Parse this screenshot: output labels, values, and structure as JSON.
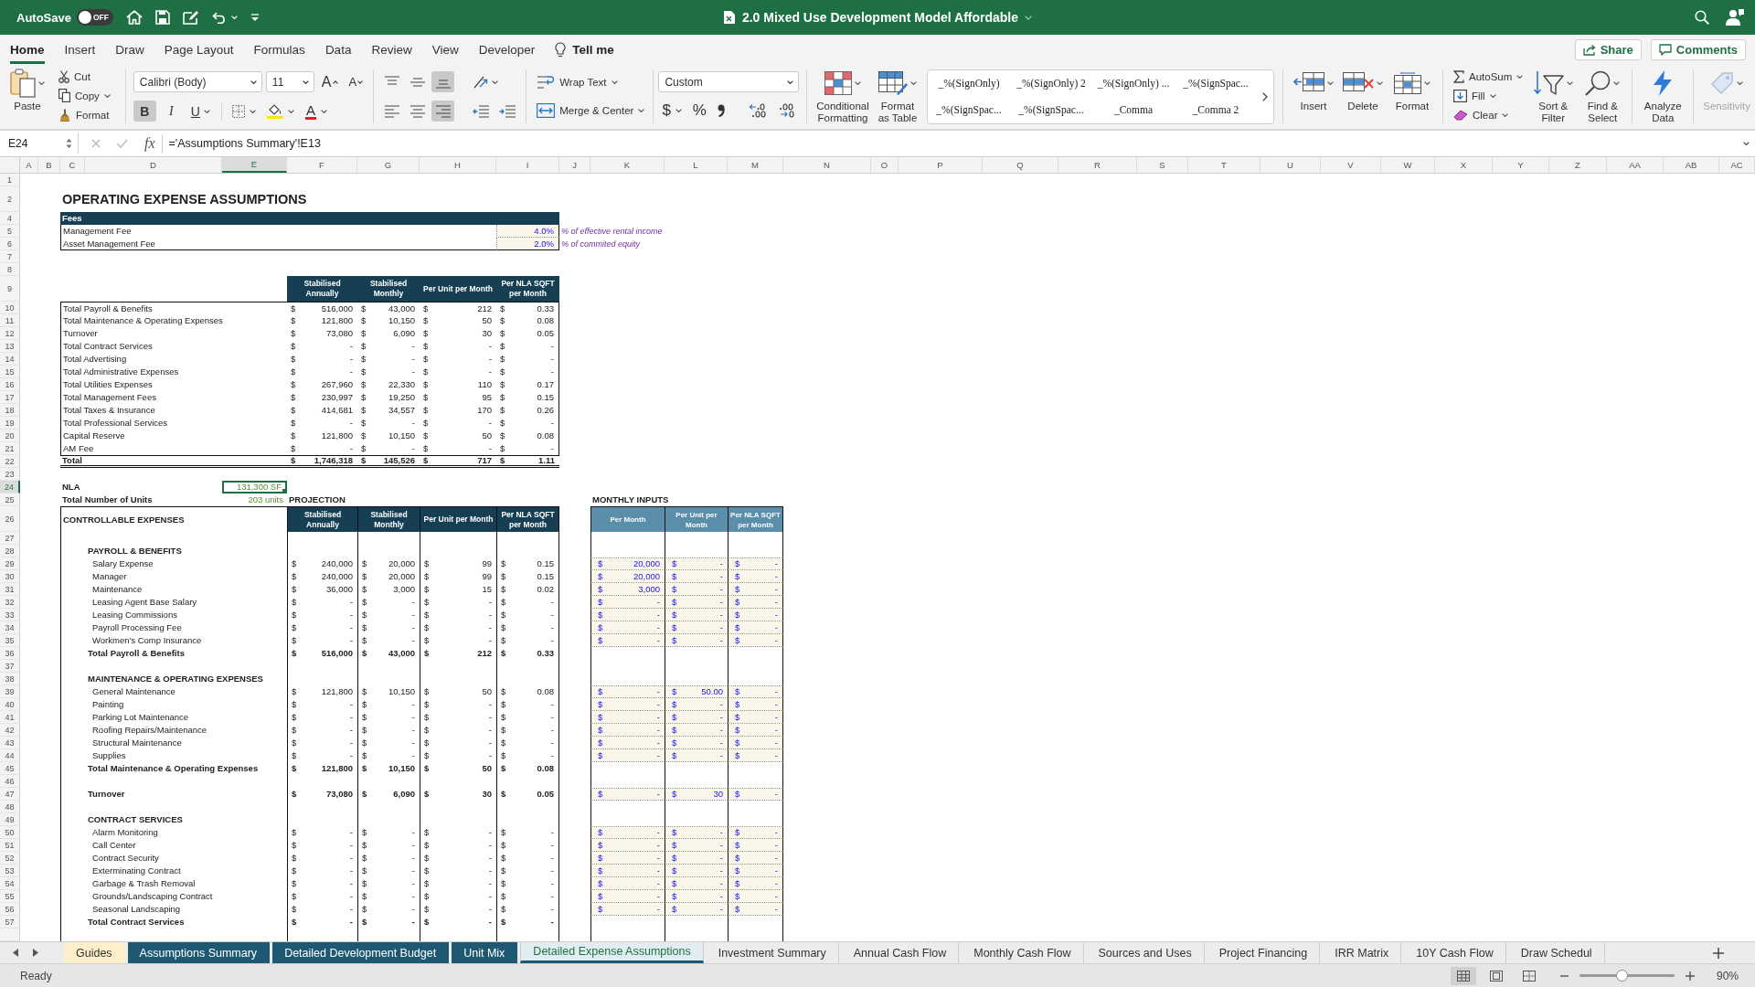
{
  "title_bar": {
    "autosave": {
      "label": "AutoSave",
      "toggle_text": "OFF",
      "on": false
    },
    "document_title": "2.0 Mixed Use Development Model Affordable"
  },
  "ribbon_tabs": [
    {
      "label": "Home",
      "selected": true
    },
    {
      "label": "Insert",
      "selected": false
    },
    {
      "label": "Draw",
      "selected": false
    },
    {
      "label": "Page Layout",
      "selected": false
    },
    {
      "label": "Formulas",
      "selected": false
    },
    {
      "label": "Data",
      "selected": false
    },
    {
      "label": "Review",
      "selected": false
    },
    {
      "label": "View",
      "selected": false
    },
    {
      "label": "Developer",
      "selected": false
    }
  ],
  "tell_me": "Tell me",
  "share_button": "Share",
  "comments_button": "Comments",
  "ribbon": {
    "clipboard": {
      "paste": "Paste",
      "cut": "Cut",
      "copy": "Copy",
      "format_painter": "Format"
    },
    "font": {
      "name": "Calibri (Body)",
      "size": "11",
      "grow": "A",
      "shrink": "A",
      "styles": [
        {
          "kind": "bold",
          "label": "B",
          "on": true
        },
        {
          "kind": "italic",
          "label": "I",
          "on": false
        },
        {
          "kind": "underline",
          "label": "U",
          "on": false
        }
      ],
      "font_color": "A"
    },
    "alignment": {
      "vertical": [
        {
          "kind": "top",
          "selected": false
        },
        {
          "kind": "middle",
          "selected": false
        },
        {
          "kind": "bottom",
          "selected": true
        }
      ],
      "horizontal": [
        {
          "kind": "left",
          "selected": false
        },
        {
          "kind": "center",
          "selected": false
        },
        {
          "kind": "right",
          "selected": true
        }
      ],
      "wrap_text": "Wrap Text",
      "merge_center": "Merge & Center"
    },
    "number": {
      "format": "Custom",
      "currency": "$",
      "percent": "%"
    },
    "conditional_formatting": "Conditional Formatting",
    "format_as_table": "Format as Table",
    "cell_styles": [
      "_%(SignOnly)",
      "_%(SignOnly) 2",
      "_%(SignOnly) ...",
      "_%(SignSpac...",
      "_%(SignSpac...",
      "_%(SignSpac...",
      "_Comma",
      "_Comma 2"
    ],
    "cells": [
      {
        "kind": "insert",
        "label": "Insert"
      },
      {
        "kind": "delete",
        "label": "Delete"
      },
      {
        "kind": "format",
        "label": "Format"
      }
    ],
    "editing": {
      "autosum": "AutoSum",
      "fill": "Fill",
      "clear": "Clear",
      "sort_filter": "Sort & Filter",
      "find_select": "Find & Select"
    },
    "analyze_data": "Analyze Data",
    "sensitivity": {
      "label": "Sensitivity",
      "disabled": true
    }
  },
  "formula_bar": {
    "name_box": "E24",
    "function_label": "fx",
    "formula": "='Assumptions Summary'!E13"
  },
  "sheet": {
    "columns": [
      {
        "label": "A",
        "selected": false
      },
      {
        "label": "B",
        "selected": false
      },
      {
        "label": "C",
        "selected": false
      },
      {
        "label": "D",
        "selected": false
      },
      {
        "label": "E",
        "selected": true
      },
      {
        "label": "F",
        "selected": false
      },
      {
        "label": "G",
        "selected": false
      },
      {
        "label": "H",
        "selected": false
      },
      {
        "label": "I",
        "selected": false
      },
      {
        "label": "J",
        "selected": false
      },
      {
        "label": "K",
        "selected": false
      },
      {
        "label": "L",
        "selected": false
      },
      {
        "label": "M",
        "selected": false
      },
      {
        "label": "N",
        "selected": false
      },
      {
        "label": "O",
        "selected": false
      },
      {
        "label": "P",
        "selected": false
      },
      {
        "label": "Q",
        "selected": false
      },
      {
        "label": "R",
        "selected": false
      },
      {
        "label": "S",
        "selected": false
      },
      {
        "label": "T",
        "selected": false
      },
      {
        "label": "U",
        "selected": false
      },
      {
        "label": "V",
        "selected": false
      },
      {
        "label": "W",
        "selected": false
      },
      {
        "label": "X",
        "selected": false
      },
      {
        "label": "Y",
        "selected": false
      },
      {
        "label": "Z",
        "selected": false
      },
      {
        "label": "AA",
        "selected": false
      },
      {
        "label": "AB",
        "selected": false
      },
      {
        "label": "AC",
        "selected": false
      }
    ],
    "rows": [
      {
        "number": "1",
        "selected": false,
        "kind": "blank"
      },
      {
        "number": "2",
        "selected": false,
        "kind": "title",
        "text": "OPERATING EXPENSE ASSUMPTIONS"
      },
      {
        "number": "4",
        "selected": false,
        "kind": "fees_header",
        "label": "Fees"
      },
      {
        "number": "5",
        "selected": false,
        "kind": "fee",
        "label": "Management Fee",
        "value": "4.0%",
        "note": "% of effective rental income"
      },
      {
        "number": "6",
        "selected": false,
        "kind": "fee",
        "label": "Asset Management Fee",
        "value": "2.0%",
        "note": "% of commited equity"
      },
      {
        "number": "7",
        "selected": false,
        "kind": "blank"
      },
      {
        "number": "8",
        "selected": false,
        "kind": "blank"
      },
      {
        "number": "9",
        "selected": false,
        "kind": "summary_header",
        "headers": [
          "Stabilised Annually",
          "Stabilised Monthly",
          "Per Unit per Month",
          "Per NLA SQFT per Month"
        ]
      },
      {
        "number": "10",
        "selected": false,
        "kind": "summary_item",
        "label": "Total Payroll & Benefits",
        "values": [
          [
            "$",
            "516,000"
          ],
          [
            "$",
            "43,000"
          ],
          [
            "$",
            "212"
          ],
          [
            "$",
            "0.33"
          ]
        ]
      },
      {
        "number": "11",
        "selected": false,
        "kind": "summary_item",
        "label": "Total Maintenance & Operating Expenses",
        "values": [
          [
            "$",
            "121,800"
          ],
          [
            "$",
            "10,150"
          ],
          [
            "$",
            "50"
          ],
          [
            "$",
            "0.08"
          ]
        ]
      },
      {
        "number": "12",
        "selected": false,
        "kind": "summary_item",
        "label": "Turnover",
        "values": [
          [
            "$",
            "73,080"
          ],
          [
            "$",
            "6,090"
          ],
          [
            "$",
            "30"
          ],
          [
            "$",
            "0.05"
          ]
        ]
      },
      {
        "number": "13",
        "selected": false,
        "kind": "summary_item",
        "label": "Total Contract Services",
        "values": [
          [
            "$",
            "-"
          ],
          [
            "$",
            "-"
          ],
          [
            "$",
            "-"
          ],
          [
            "$",
            "-"
          ]
        ]
      },
      {
        "number": "14",
        "selected": false,
        "kind": "summary_item",
        "label": "Total Advertising",
        "values": [
          [
            "$",
            "-"
          ],
          [
            "$",
            "-"
          ],
          [
            "$",
            "-"
          ],
          [
            "$",
            "-"
          ]
        ]
      },
      {
        "number": "15",
        "selected": false,
        "kind": "summary_item",
        "label": "Total Administrative Expenses",
        "values": [
          [
            "$",
            "-"
          ],
          [
            "$",
            "-"
          ],
          [
            "$",
            "-"
          ],
          [
            "$",
            "-"
          ]
        ]
      },
      {
        "number": "16",
        "selected": false,
        "kind": "summary_item",
        "label": "Total Utilities Expenses",
        "values": [
          [
            "$",
            "267,960"
          ],
          [
            "$",
            "22,330"
          ],
          [
            "$",
            "110"
          ],
          [
            "$",
            "0.17"
          ]
        ]
      },
      {
        "number": "17",
        "selected": false,
        "kind": "summary_item",
        "label": "Total Management Fees",
        "values": [
          [
            "$",
            "230,997"
          ],
          [
            "$",
            "19,250"
          ],
          [
            "$",
            "95"
          ],
          [
            "$",
            "0.15"
          ]
        ]
      },
      {
        "number": "18",
        "selected": false,
        "kind": "summary_item",
        "label": "Total Taxes & Insurance",
        "values": [
          [
            "$",
            "414,681"
          ],
          [
            "$",
            "34,557"
          ],
          [
            "$",
            "170"
          ],
          [
            "$",
            "0.26"
          ]
        ]
      },
      {
        "number": "19",
        "selected": false,
        "kind": "summary_item",
        "label": "Total Professional Services",
        "values": [
          [
            "$",
            "-"
          ],
          [
            "$",
            "-"
          ],
          [
            "$",
            "-"
          ],
          [
            "$",
            "-"
          ]
        ]
      },
      {
        "number": "20",
        "selected": false,
        "kind": "summary_item",
        "label": "Capital Reserve",
        "values": [
          [
            "$",
            "121,800"
          ],
          [
            "$",
            "10,150"
          ],
          [
            "$",
            "50"
          ],
          [
            "$",
            "0.08"
          ]
        ]
      },
      {
        "number": "21",
        "selected": false,
        "kind": "summary_item",
        "label": "AM Fee",
        "values": [
          [
            "$",
            "-"
          ],
          [
            "$",
            "-"
          ],
          [
            "$",
            "-"
          ],
          [
            "$",
            "-"
          ]
        ]
      },
      {
        "number": "22",
        "selected": false,
        "kind": "summary_total",
        "label": "Total",
        "values": [
          [
            "$",
            "1,746,318"
          ],
          [
            "$",
            "145,526"
          ],
          [
            "$",
            "717"
          ],
          [
            "$",
            "1.11"
          ]
        ]
      },
      {
        "number": "23",
        "selected": false,
        "kind": "blank"
      },
      {
        "number": "24",
        "selected": true,
        "kind": "nla",
        "label": "NLA",
        "value": "131,300 SF"
      },
      {
        "number": "25",
        "selected": false,
        "kind": "units",
        "label": "Total Number of Units",
        "value": "203 units",
        "projection": "PROJECTION",
        "inputs_title": "MONTHLY INPUTS"
      },
      {
        "number": "26",
        "selected": false,
        "kind": "projection_header",
        "label": "CONTROLLABLE EXPENSES",
        "headers": [
          "Stabilised Annually",
          "Stabilised Monthly",
          "Per Unit per Month",
          "Per NLA SQFT per Month"
        ],
        "input_headers": [
          "Per Month",
          "Per Unit per Month",
          "Per NLA SQFT per Month"
        ]
      },
      {
        "number": "27",
        "selected": false,
        "kind": "gap"
      },
      {
        "number": "28",
        "selected": false,
        "kind": "section",
        "label": "PAYROLL & BENEFITS"
      },
      {
        "number": "29",
        "selected": false,
        "kind": "item",
        "label": "Salary Expense",
        "values": [
          [
            "$",
            "240,000"
          ],
          [
            "$",
            "20,000"
          ],
          [
            "$",
            "99"
          ],
          [
            "$",
            "0.15"
          ]
        ],
        "inputs": [
          [
            "$",
            "20,000"
          ],
          [
            "$",
            "-"
          ],
          [
            "$",
            "-"
          ]
        ]
      },
      {
        "number": "30",
        "selected": false,
        "kind": "item",
        "label": "Manager",
        "values": [
          [
            "$",
            "240,000"
          ],
          [
            "$",
            "20,000"
          ],
          [
            "$",
            "99"
          ],
          [
            "$",
            "0.15"
          ]
        ],
        "inputs": [
          [
            "$",
            "20,000"
          ],
          [
            "$",
            "-"
          ],
          [
            "$",
            "-"
          ]
        ]
      },
      {
        "number": "31",
        "selected": false,
        "kind": "item",
        "label": "Maintenance",
        "values": [
          [
            "$",
            "36,000"
          ],
          [
            "$",
            "3,000"
          ],
          [
            "$",
            "15"
          ],
          [
            "$",
            "0.02"
          ]
        ],
        "inputs": [
          [
            "$",
            "3,000"
          ],
          [
            "$",
            "-"
          ],
          [
            "$",
            "-"
          ]
        ]
      },
      {
        "number": "32",
        "selected": false,
        "kind": "item",
        "label": "Leasing Agent Base Salary",
        "values": [
          [
            "$",
            "-"
          ],
          [
            "$",
            "-"
          ],
          [
            "$",
            "-"
          ],
          [
            "$",
            "-"
          ]
        ],
        "inputs": [
          [
            "$",
            "-"
          ],
          [
            "$",
            "-"
          ],
          [
            "$",
            "-"
          ]
        ]
      },
      {
        "number": "33",
        "selected": false,
        "kind": "item",
        "label": "Leasing Commissions",
        "values": [
          [
            "$",
            "-"
          ],
          [
            "$",
            "-"
          ],
          [
            "$",
            "-"
          ],
          [
            "$",
            "-"
          ]
        ],
        "inputs": [
          [
            "$",
            "-"
          ],
          [
            "$",
            "-"
          ],
          [
            "$",
            "-"
          ]
        ]
      },
      {
        "number": "34",
        "selected": false,
        "kind": "item",
        "label": "Payroll Processing Fee",
        "values": [
          [
            "$",
            "-"
          ],
          [
            "$",
            "-"
          ],
          [
            "$",
            "-"
          ],
          [
            "$",
            "-"
          ]
        ],
        "inputs": [
          [
            "$",
            "-"
          ],
          [
            "$",
            "-"
          ],
          [
            "$",
            "-"
          ]
        ]
      },
      {
        "number": "35",
        "selected": false,
        "kind": "item",
        "label": "Workmen's Comp Insurance",
        "values": [
          [
            "$",
            "-"
          ],
          [
            "$",
            "-"
          ],
          [
            "$",
            "-"
          ],
          [
            "$",
            "-"
          ]
        ],
        "inputs": [
          [
            "$",
            "-"
          ],
          [
            "$",
            "-"
          ],
          [
            "$",
            "-"
          ]
        ]
      },
      {
        "number": "36",
        "selected": false,
        "kind": "subtotal",
        "label": "Total Payroll & Benefits",
        "values": [
          [
            "$",
            "516,000"
          ],
          [
            "$",
            "43,000"
          ],
          [
            "$",
            "212"
          ],
          [
            "$",
            "0.33"
          ]
        ]
      },
      {
        "number": "37",
        "selected": false,
        "kind": "gap"
      },
      {
        "number": "38",
        "selected": false,
        "kind": "section",
        "label": "MAINTENANCE & OPERATING EXPENSES"
      },
      {
        "number": "39",
        "selected": false,
        "kind": "item",
        "label": "General Maintenance",
        "values": [
          [
            "$",
            "121,800"
          ],
          [
            "$",
            "10,150"
          ],
          [
            "$",
            "50"
          ],
          [
            "$",
            "0.08"
          ]
        ],
        "inputs": [
          [
            "$",
            "-"
          ],
          [
            "$",
            "50.00"
          ],
          [
            "$",
            "-"
          ]
        ]
      },
      {
        "number": "40",
        "selected": false,
        "kind": "item",
        "label": "Painting",
        "values": [
          [
            "$",
            "-"
          ],
          [
            "$",
            "-"
          ],
          [
            "$",
            "-"
          ],
          [
            "$",
            "-"
          ]
        ],
        "inputs": [
          [
            "$",
            "-"
          ],
          [
            "$",
            "-"
          ],
          [
            "$",
            "-"
          ]
        ]
      },
      {
        "number": "41",
        "selected": false,
        "kind": "item",
        "label": "Parking Lot Maintenance",
        "values": [
          [
            "$",
            "-"
          ],
          [
            "$",
            "-"
          ],
          [
            "$",
            "-"
          ],
          [
            "$",
            "-"
          ]
        ],
        "inputs": [
          [
            "$",
            "-"
          ],
          [
            "$",
            "-"
          ],
          [
            "$",
            "-"
          ]
        ]
      },
      {
        "number": "42",
        "selected": false,
        "kind": "item",
        "label": "Roofing Repairs/Maintenance",
        "values": [
          [
            "$",
            "-"
          ],
          [
            "$",
            "-"
          ],
          [
            "$",
            "-"
          ],
          [
            "$",
            "-"
          ]
        ],
        "inputs": [
          [
            "$",
            "-"
          ],
          [
            "$",
            "-"
          ],
          [
            "$",
            "-"
          ]
        ]
      },
      {
        "number": "43",
        "selected": false,
        "kind": "item",
        "label": "Structural Maintenance",
        "values": [
          [
            "$",
            "-"
          ],
          [
            "$",
            "-"
          ],
          [
            "$",
            "-"
          ],
          [
            "$",
            "-"
          ]
        ],
        "inputs": [
          [
            "$",
            "-"
          ],
          [
            "$",
            "-"
          ],
          [
            "$",
            "-"
          ]
        ]
      },
      {
        "number": "44",
        "selected": false,
        "kind": "item",
        "label": "Supplies",
        "values": [
          [
            "$",
            "-"
          ],
          [
            "$",
            "-"
          ],
          [
            "$",
            "-"
          ],
          [
            "$",
            "-"
          ]
        ],
        "inputs": [
          [
            "$",
            "-"
          ],
          [
            "$",
            "-"
          ],
          [
            "$",
            "-"
          ]
        ]
      },
      {
        "number": "45",
        "selected": false,
        "kind": "subtotal",
        "label": "Total Maintenance & Operating Expenses",
        "values": [
          [
            "$",
            "121,800"
          ],
          [
            "$",
            "10,150"
          ],
          [
            "$",
            "50"
          ],
          [
            "$",
            "0.08"
          ]
        ]
      },
      {
        "number": "46",
        "selected": false,
        "kind": "gap"
      },
      {
        "number": "47",
        "selected": false,
        "kind": "key_item",
        "label": "Turnover",
        "values": [
          [
            "$",
            "73,080"
          ],
          [
            "$",
            "6,090"
          ],
          [
            "$",
            "30"
          ],
          [
            "$",
            "0.05"
          ]
        ],
        "inputs": [
          [
            "$",
            "-"
          ],
          [
            "$",
            "30"
          ],
          [
            "$",
            "-"
          ]
        ]
      },
      {
        "number": "48",
        "selected": false,
        "kind": "gap"
      },
      {
        "number": "49",
        "selected": false,
        "kind": "section",
        "label": "CONTRACT SERVICES"
      },
      {
        "number": "50",
        "selected": false,
        "kind": "item",
        "label": "Alarm Monitoring",
        "values": [
          [
            "$",
            "-"
          ],
          [
            "$",
            "-"
          ],
          [
            "$",
            "-"
          ],
          [
            "$",
            "-"
          ]
        ],
        "inputs": [
          [
            "$",
            "-"
          ],
          [
            "$",
            "-"
          ],
          [
            "$",
            "-"
          ]
        ]
      },
      {
        "number": "51",
        "selected": false,
        "kind": "item",
        "label": "Call Center",
        "values": [
          [
            "$",
            "-"
          ],
          [
            "$",
            "-"
          ],
          [
            "$",
            "-"
          ],
          [
            "$",
            "-"
          ]
        ],
        "inputs": [
          [
            "$",
            "-"
          ],
          [
            "$",
            "-"
          ],
          [
            "$",
            "-"
          ]
        ]
      },
      {
        "number": "52",
        "selected": false,
        "kind": "item",
        "label": "Contract Security",
        "values": [
          [
            "$",
            "-"
          ],
          [
            "$",
            "-"
          ],
          [
            "$",
            "-"
          ],
          [
            "$",
            "-"
          ]
        ],
        "inputs": [
          [
            "$",
            "-"
          ],
          [
            "$",
            "-"
          ],
          [
            "$",
            "-"
          ]
        ]
      },
      {
        "number": "53",
        "selected": false,
        "kind": "item",
        "label": "Exterminating Contract",
        "values": [
          [
            "$",
            "-"
          ],
          [
            "$",
            "-"
          ],
          [
            "$",
            "-"
          ],
          [
            "$",
            "-"
          ]
        ],
        "inputs": [
          [
            "$",
            "-"
          ],
          [
            "$",
            "-"
          ],
          [
            "$",
            "-"
          ]
        ]
      },
      {
        "number": "54",
        "selected": false,
        "kind": "item",
        "label": "Garbage & Trash Removal",
        "values": [
          [
            "$",
            "-"
          ],
          [
            "$",
            "-"
          ],
          [
            "$",
            "-"
          ],
          [
            "$",
            "-"
          ]
        ],
        "inputs": [
          [
            "$",
            "-"
          ],
          [
            "$",
            "-"
          ],
          [
            "$",
            "-"
          ]
        ]
      },
      {
        "number": "55",
        "selected": false,
        "kind": "item",
        "label": "Grounds/Landscaping Contract",
        "values": [
          [
            "$",
            "-"
          ],
          [
            "$",
            "-"
          ],
          [
            "$",
            "-"
          ],
          [
            "$",
            "-"
          ]
        ],
        "inputs": [
          [
            "$",
            "-"
          ],
          [
            "$",
            "-"
          ],
          [
            "$",
            "-"
          ]
        ]
      },
      {
        "number": "56",
        "selected": false,
        "kind": "item",
        "label": "Seasonal Landscaping",
        "values": [
          [
            "$",
            "-"
          ],
          [
            "$",
            "-"
          ],
          [
            "$",
            "-"
          ],
          [
            "$",
            "-"
          ]
        ],
        "inputs": [
          [
            "$",
            "-"
          ],
          [
            "$",
            "-"
          ],
          [
            "$",
            "-"
          ]
        ]
      },
      {
        "number": "57",
        "selected": false,
        "kind": "subtotal",
        "label": "Total Contract Services",
        "values": [
          [
            "$",
            "-"
          ],
          [
            "$",
            "-"
          ],
          [
            "$",
            "-"
          ],
          [
            "$",
            "-"
          ]
        ]
      }
    ]
  },
  "sheet_tabs": [
    {
      "label": "Guides",
      "selected": false,
      "color": "#fcefc9"
    },
    {
      "label": "Assumptions Summary",
      "selected": false,
      "color": "#1f5873"
    },
    {
      "label": "Detailed Development Budget",
      "selected": false,
      "color": "#1f5873"
    },
    {
      "label": "Unit Mix",
      "selected": false,
      "color": "#1f5873"
    },
    {
      "label": "Detailed Expense Assumptions",
      "selected": true,
      "color": "#1f5873"
    },
    {
      "label": "Investment Summary",
      "selected": false
    },
    {
      "label": "Annual Cash Flow",
      "selected": false
    },
    {
      "label": "Monthly Cash Flow",
      "selected": false
    },
    {
      "label": "Sources and Uses",
      "selected": false
    },
    {
      "label": "Project Financing",
      "selected": false
    },
    {
      "label": "IRR Matrix",
      "selected": false
    },
    {
      "label": "10Y Cash Flow",
      "selected": false
    },
    {
      "label": "Draw Schedul",
      "selected": false
    }
  ],
  "status_bar": {
    "status": "Ready",
    "views": [
      {
        "kind": "normal",
        "selected": true
      },
      {
        "kind": "page_layout",
        "selected": false
      },
      {
        "kind": "page_break",
        "selected": false
      }
    ],
    "zoom": {
      "level": 0.44,
      "label": "90%"
    }
  }
}
